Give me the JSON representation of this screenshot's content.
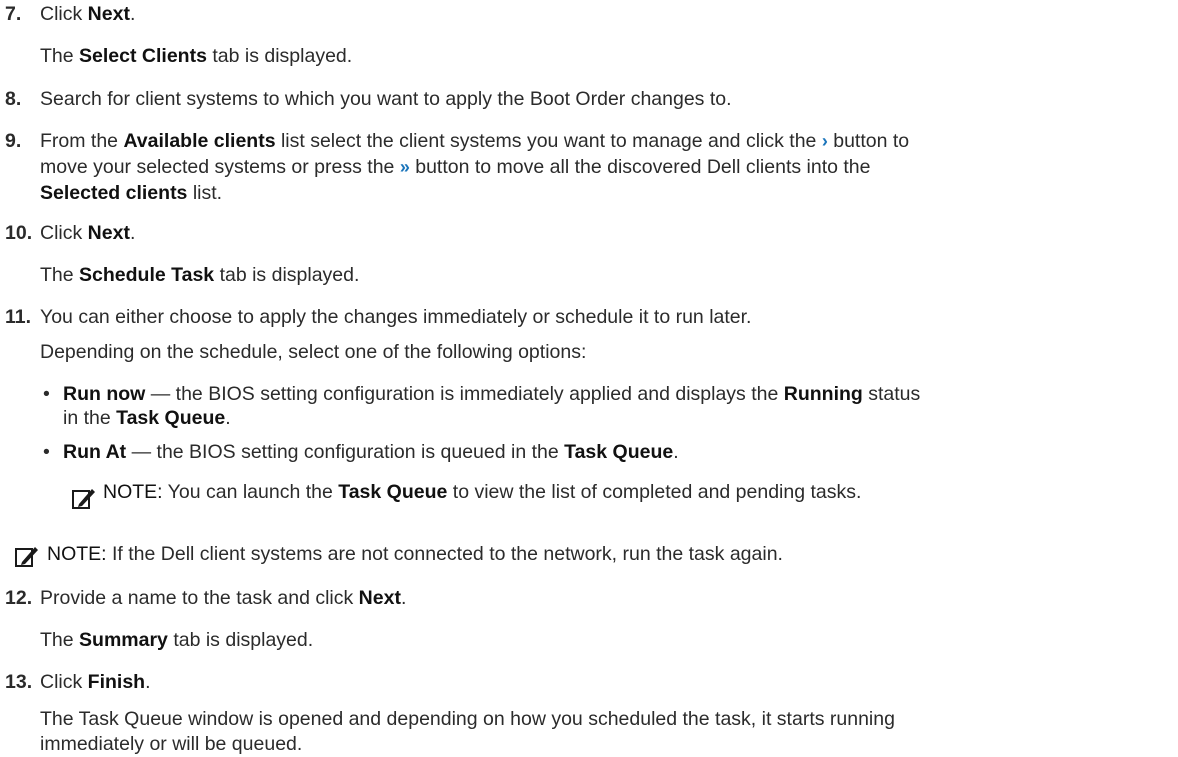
{
  "steps": {
    "s7": {
      "num": "7.",
      "pre": "Click ",
      "b1": "Next",
      "post": "."
    },
    "s7r": {
      "pre": "The ",
      "b1": "Select Clients",
      "post": " tab is displayed."
    },
    "s8": {
      "num": "8.",
      "text": "Search for client systems to which you want to apply the Boot Order changes to."
    },
    "s9": {
      "num": "9.",
      "l1_pre": "From the ",
      "l1_b1": "Available clients",
      "l1_mid": " list select the client systems you want to manage and click the ",
      "chev_single": "›",
      "l1_post": " button to",
      "l2_pre": "move your selected systems or press the ",
      "chev_double": "»",
      "l2_post": " button to move all the discovered Dell clients into the",
      "l3_b1": "Selected clients",
      "l3_post": " list."
    },
    "s10": {
      "num": "10.",
      "pre": "Click ",
      "b1": "Next",
      "post": "."
    },
    "s10r": {
      "pre": "The ",
      "b1": "Schedule Task",
      "post": " tab is displayed."
    },
    "s11": {
      "num": "11.",
      "text": "You can either choose to apply the changes immediately or schedule it to run later."
    },
    "s11r": {
      "text": "Depending on the schedule, select one of the following options:"
    },
    "bullets": {
      "run_now": {
        "b1": "Run now",
        "mid1": " — the BIOS setting configuration is immediately applied and displays the ",
        "b2": "Running",
        "post1": " status",
        "l2_pre": "in the ",
        "l2_b1": "Task Queue",
        "l2_post": "."
      },
      "run_at": {
        "b1": "Run At",
        "mid1": " — the BIOS setting configuration is queued in the ",
        "b2": "Task Queue",
        "post1": "."
      }
    },
    "note1": {
      "label": "NOTE:",
      "pre": " You can launch the ",
      "b1": "Task Queue",
      "post": " to view the list of completed and pending tasks."
    },
    "note2": {
      "label": "NOTE:",
      "text": " If the Dell client systems are not connected to the network, run the task again."
    },
    "s12": {
      "num": "12.",
      "pre": "Provide a name to the task and click ",
      "b1": "Next",
      "post": "."
    },
    "s12r": {
      "pre": "The ",
      "b1": "Summary",
      "post": " tab is displayed."
    },
    "s13": {
      "num": "13.",
      "pre": "Click ",
      "b1": "Finish",
      "post": "."
    },
    "s13r": {
      "l1": "The Task Queue window is opened and depending on how you scheduled the task, it starts running",
      "l2": "immediately or will be queued."
    }
  },
  "colors": {
    "text": "#2b2b2b",
    "chevron": "#1b75bb",
    "note_icon": "#1a1a1a"
  },
  "icons": {
    "note": "pencil-note-icon"
  }
}
